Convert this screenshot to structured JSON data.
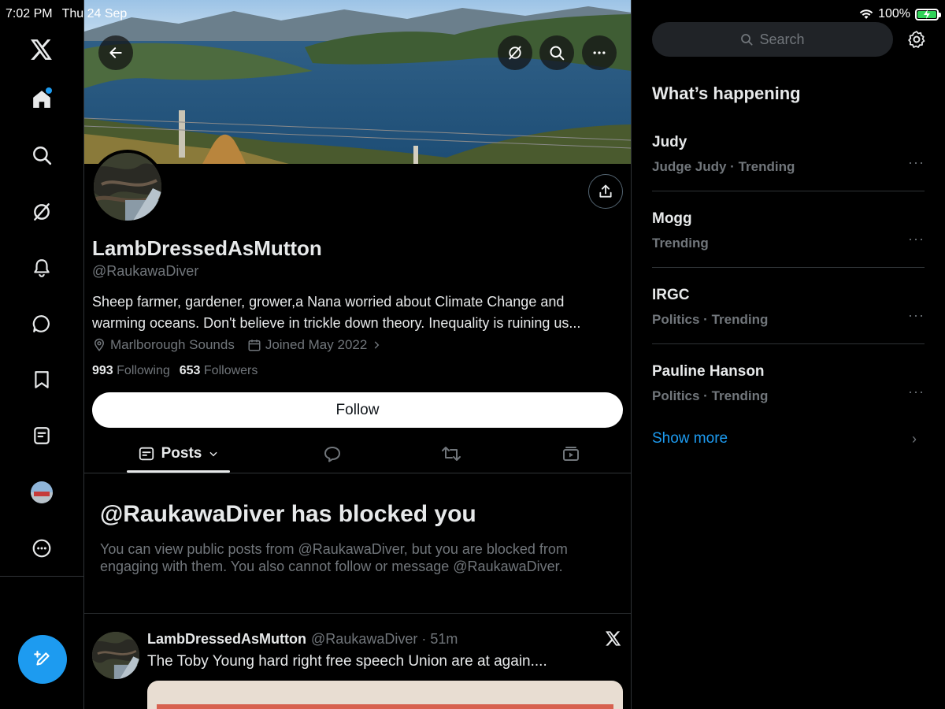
{
  "status_bar": {
    "time": "7:02 PM",
    "date": "Thu 24 Sep",
    "battery": "100%"
  },
  "nav": {
    "items": [
      "x-logo-icon",
      "home-icon",
      "search-icon",
      "grok-icon",
      "notifications-icon",
      "messages-icon",
      "bookmarks-icon",
      "lists-icon",
      "profile-avatar",
      "more-icon"
    ],
    "compose_icon": "compose-icon"
  },
  "profile": {
    "display_name": "LambDressedAsMutton",
    "handle": "@RaukawaDiver",
    "bio": "Sheep farmer, gardener, grower,a Nana worried about Climate Change and warming oceans. Don't believe in trickle down theory. Inequality is ruining us...",
    "location": "Marlborough Sounds",
    "joined": "Joined May 2022",
    "following_count": "993",
    "following_label": "Following",
    "followers_count": "653",
    "followers_label": "Followers",
    "follow_button": "Follow"
  },
  "tabs": {
    "posts_label": "Posts"
  },
  "blocked": {
    "title": "@RaukawaDiver has blocked you",
    "text": "You can view public posts from @RaukawaDiver, but you are blocked from engaging with them. You also cannot follow or message @RaukawaDiver."
  },
  "post": {
    "author": "LambDressedAsMutton",
    "handle_time": "@RaukawaDiver · 51m",
    "text": "The Toby Young hard right free speech Union are at again...."
  },
  "sidebar": {
    "search_placeholder": "Search",
    "heading": "What’s happening",
    "trends": [
      {
        "name": "Judy",
        "meta": "Judge Judy · Trending"
      },
      {
        "name": "Mogg",
        "meta": "Trending"
      },
      {
        "name": "IRGC",
        "meta": "Politics · Trending"
      },
      {
        "name": "Pauline Hanson",
        "meta": "Politics · Trending"
      }
    ],
    "show_more": "Show more",
    "more_glyph": "···",
    "chevron": "›"
  },
  "colors": {
    "accent": "#1d9bf0",
    "background": "#000000",
    "muted": "#71767b",
    "border": "#2f3336"
  }
}
